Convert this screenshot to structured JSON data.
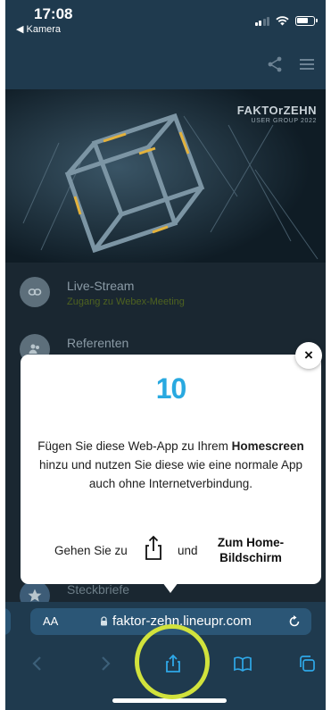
{
  "status_bar": {
    "time": "17:08",
    "back_label": "Kamera"
  },
  "header": {
    "share_icon": "share-icon",
    "menu_icon": "menu-icon"
  },
  "hero": {
    "logo_brand": "FAKTOrZEHN",
    "logo_sub": "USER GROUP 2022"
  },
  "list": {
    "items": [
      {
        "title": "Live-Stream",
        "subtitle": "Zugang zu Webex-Meeting",
        "icon": "link-icon"
      },
      {
        "title": "Referenten",
        "subtitle": "",
        "icon": "people-icon"
      }
    ],
    "bottom_item": {
      "title": "Steckbriefe",
      "icon": "star-icon"
    }
  },
  "popup": {
    "logo": "10",
    "text_part1": "Fügen Sie diese Web-App zu Ihrem ",
    "text_bold": "Homescreen",
    "text_part2": " hinzu und nutzen Sie diese wie eine normale App auch ohne Internetverbindung.",
    "step_label": "Gehen Sie zu",
    "and_label": "und",
    "target_label": "Zum Home-Bildschirm",
    "close_label": "×"
  },
  "safari": {
    "aa_label": "AA",
    "url": "faktor-zehn.lineupr.com",
    "tools": [
      "back-icon",
      "forward-icon",
      "share-icon",
      "bookmarks-icon",
      "tabs-icon"
    ]
  },
  "colors": {
    "accent": "#29a9e0",
    "highlight": "#d1e23c",
    "bar": "#1f3a4e",
    "url_pill": "#2b5676"
  }
}
